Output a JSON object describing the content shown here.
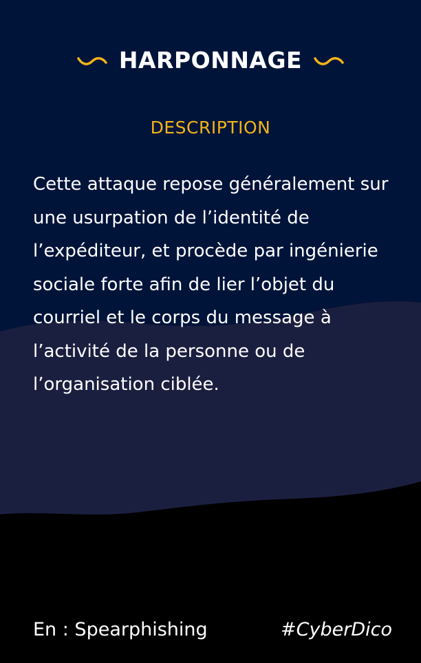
{
  "card": {
    "title": "HARPONNAGE",
    "section_label": "DESCRIPTION",
    "description": "Cette attaque repose généralement sur une usurpation de l’identité de l’expéditeur, et procède par ingénierie sociale forte afin de lier l’objet du courriel et le corps du message à l’activité de la personne ou de l’organisation ciblée.",
    "english_term": "En : Spearphishing",
    "hashtag": "#CyberDico"
  },
  "colors": {
    "top_background": "#00143a",
    "middle_band": "#1b1f3f",
    "bottom_background": "#000000",
    "accent": "#f2b419",
    "text": "#ffffff"
  },
  "icons": {
    "title_left": "squiggle-icon",
    "title_right": "squiggle-icon"
  }
}
